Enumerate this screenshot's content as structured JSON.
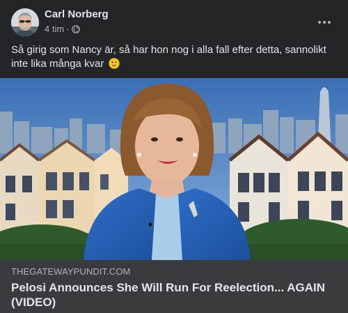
{
  "post": {
    "author": "Carl Norberg",
    "timestamp": "4 tim",
    "separator": "·",
    "privacy_icon": "globe-icon",
    "more_icon": "more-horizontal-icon",
    "text": "Så girig som Nancy är, så har hon nog i alla fall efter detta, sannolikt inte lika många kvar",
    "emoji": "winking-face-icon"
  },
  "link_preview": {
    "domain": "THEGATEWAYPUNDIT.COM",
    "title": "Pelosi Announces She Will Run For Reelection... AGAIN (VIDEO)"
  },
  "colors": {
    "background": "#242526",
    "footer": "#3a3b3c",
    "primary_text": "#e4e6eb",
    "secondary_text": "#b0b3b8"
  }
}
